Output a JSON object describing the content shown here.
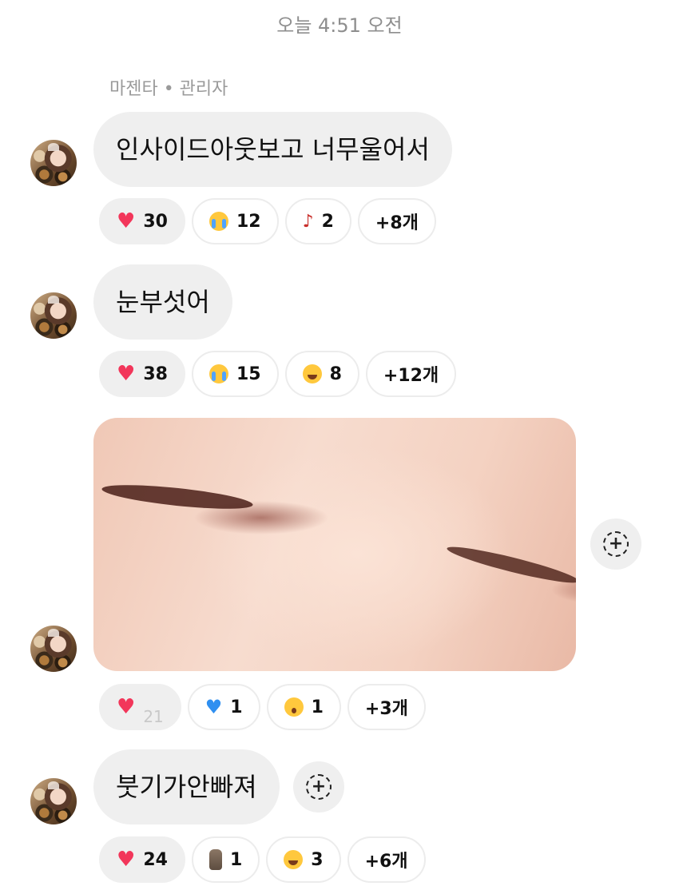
{
  "header": {
    "timestamp": "오늘 4:51 오전"
  },
  "sender": {
    "label": "마젠타 • 관리자"
  },
  "messages": [
    {
      "text": "인사이드아웃보고 너무울어서",
      "reactions": [
        {
          "emoji": "heart",
          "count": "30"
        },
        {
          "emoji": "crying-face",
          "count": "12"
        },
        {
          "emoji": "guitar",
          "count": "2"
        },
        {
          "more": "+8개"
        }
      ]
    },
    {
      "text": "눈부섯어",
      "reactions": [
        {
          "emoji": "heart",
          "count": "38"
        },
        {
          "emoji": "crying-face",
          "count": "15"
        },
        {
          "emoji": "tears-of-joy",
          "count": "8"
        },
        {
          "more": "+12개"
        }
      ]
    },
    {
      "image": "closed-eyes-photo",
      "reactions": [
        {
          "emoji": "heart",
          "count": "21"
        },
        {
          "emoji": "blue-heart",
          "count": "1"
        },
        {
          "emoji": "astonished-face",
          "count": "1"
        },
        {
          "more": "+3개"
        }
      ]
    },
    {
      "text": "붓기가안빠져",
      "reactions": [
        {
          "emoji": "heart",
          "count": "24"
        },
        {
          "emoji": "moai",
          "count": "1"
        },
        {
          "emoji": "tears-of-joy",
          "count": "3"
        },
        {
          "more": "+6개"
        }
      ]
    }
  ],
  "colors": {
    "bubble": "#efefef",
    "heart": "#f2365a",
    "meta_text": "#8e8e8e"
  }
}
